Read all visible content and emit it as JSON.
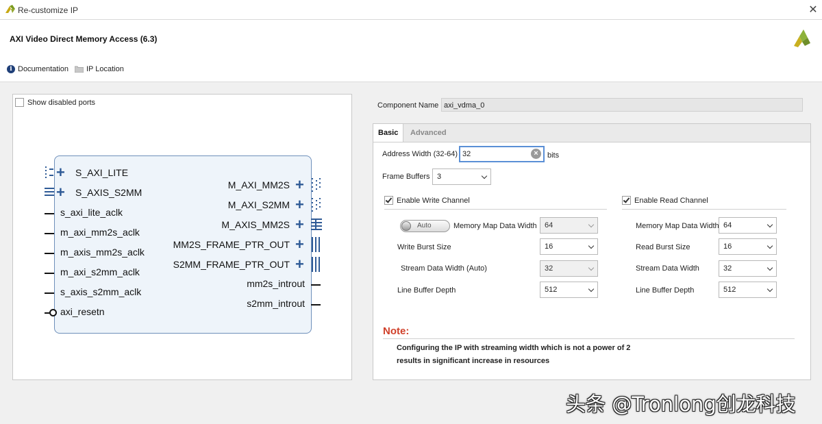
{
  "window": {
    "title": "Re-customize IP",
    "close_glyph": "✕"
  },
  "header": {
    "ip_name": "AXI Video Direct Memory Access (6.3)",
    "links": [
      {
        "label": "Documentation",
        "icon": "info-icon"
      },
      {
        "label": "IP Location",
        "icon": "folder-icon"
      }
    ]
  },
  "symbol": {
    "show_disabled_ports": "Show disabled ports",
    "left_ports": [
      {
        "label": "S_AXI_LITE",
        "kind": "bus"
      },
      {
        "label": "S_AXIS_S2MM",
        "kind": "bus"
      },
      {
        "label": "s_axi_lite_aclk",
        "kind": "wire"
      },
      {
        "label": "m_axi_mm2s_aclk",
        "kind": "wire"
      },
      {
        "label": "m_axis_mm2s_aclk",
        "kind": "wire"
      },
      {
        "label": "m_axi_s2mm_aclk",
        "kind": "wire"
      },
      {
        "label": "s_axis_s2mm_aclk",
        "kind": "wire"
      },
      {
        "label": "axi_resetn",
        "kind": "reset"
      }
    ],
    "right_ports": [
      {
        "label": "M_AXI_MM2S",
        "kind": "bus"
      },
      {
        "label": "M_AXI_S2MM",
        "kind": "bus"
      },
      {
        "label": "M_AXIS_MM2S",
        "kind": "bus"
      },
      {
        "label": "MM2S_FRAME_PTR_OUT",
        "kind": "bus"
      },
      {
        "label": "S2MM_FRAME_PTR_OUT",
        "kind": "bus"
      },
      {
        "label": "mm2s_introut",
        "kind": "wire"
      },
      {
        "label": "s2mm_introut",
        "kind": "wire"
      }
    ]
  },
  "config": {
    "component_name_label": "Component Name",
    "component_name": "axi_vdma_0",
    "tabs": [
      {
        "label": "Basic"
      },
      {
        "label": "Advanced"
      }
    ],
    "address_width": {
      "label": "Address Width (32-64)",
      "value": "32",
      "unit": "bits"
    },
    "frame_buffers": {
      "label": "Frame Buffers",
      "value": "3"
    },
    "write": {
      "enable_label": "Enable Write Channel",
      "auto_toggle": "Auto",
      "mm_width": {
        "label": "Memory Map Data Width",
        "value": "64"
      },
      "burst": {
        "label": "Write Burst Size",
        "value": "16"
      },
      "stream": {
        "label": "Stream Data Width (Auto)",
        "value": "32"
      },
      "line": {
        "label": "Line Buffer Depth",
        "value": "512"
      }
    },
    "read": {
      "enable_label": "Enable Read Channel",
      "mm_width": {
        "label": "Memory Map Data Width",
        "value": "64"
      },
      "burst": {
        "label": "Read Burst Size",
        "value": "16"
      },
      "stream": {
        "label": "Stream Data Width",
        "value": "32"
      },
      "line": {
        "label": "Line Buffer Depth",
        "value": "512"
      }
    },
    "note_title": "Note:",
    "note_line1": "Configuring the IP with streaming width which is not a power of 2",
    "note_line2": "results in significant increase in resources"
  },
  "watermark": "头条 @Tronlong创龙科技",
  "colors": {
    "accent_blue": "#2e5a96",
    "note_red": "#d0402a",
    "block_fill": "#eef4fa"
  }
}
